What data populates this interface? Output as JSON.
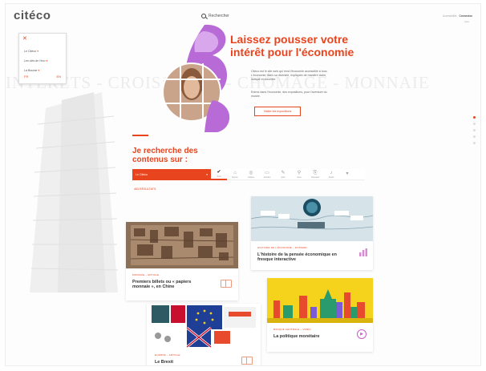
{
  "header": {
    "logo_text": "citéco",
    "logo_accent_letter": "é",
    "search_label": "Rechercher",
    "top_links": [
      "Accessibilité",
      "Connexion"
    ],
    "top_link_sub": "Aide"
  },
  "popup": {
    "close_symbol": "✕",
    "items": [
      {
        "label": "Le Citéco",
        "caret": "▾"
      },
      {
        "label": "Les clés de l'éco",
        "caret": "▾"
      },
      {
        "label": "La Bourse",
        "caret": "▾"
      }
    ],
    "footer_left": "FR",
    "footer_right": "EN"
  },
  "background": {
    "watermark": "INTÉRÊTS - CROISSANCE - CHÔMAGE - MONNAIE"
  },
  "hero": {
    "title": "Laissez pousser votre intérêt pour l'économie",
    "paragraph1": "Citéco est le site web qui rend l'économie accessible à tous. L'économie, dans sa diversité, expliquée de manière claire, ludique et concrète.",
    "paragraph2": "Entrez dans l'économie, des expositions, pour l'aventure du musée.",
    "button": "Visiter les expositions"
  },
  "side_nav": {
    "count": 5,
    "active_index": 0
  },
  "search_section": {
    "title": "Je recherche des contenus sur :",
    "select_value": "Le Citéco",
    "select_caret": "▾",
    "types": [
      {
        "symbol": "✔",
        "label": "Tous",
        "active": true
      },
      {
        "symbol": "⌂",
        "label": "Expos",
        "active": false
      },
      {
        "symbol": "◎",
        "label": "Vidéos",
        "active": false
      },
      {
        "symbol": "▭",
        "label": "Articles",
        "active": false
      },
      {
        "symbol": "✎",
        "label": "Quiz",
        "active": false
      },
      {
        "symbol": "⚲",
        "label": "Jeux",
        "active": false
      },
      {
        "symbol": "⎘",
        "label": "Dossiers",
        "active": false
      },
      {
        "symbol": "♪",
        "label": "Audio",
        "active": false
      }
    ],
    "more_caret": "▾",
    "results_label": "463 RÉSULTATS"
  },
  "cards": [
    {
      "category": "MONNAIE – ARTICLE",
      "title": "Premiers billets ou « papiers monnaie », en Chine",
      "icon": "book-icon"
    },
    {
      "category": "HISTOIRE DE L'ÉCONOMIE – DOSSIER",
      "title": "L'histoire de la pensée économique en fresque interactive",
      "icon": "chart-icon"
    },
    {
      "category": "BANQUE CENTRALE – VIDÉO",
      "title": "La politique monétaire",
      "icon": "play-icon",
      "play_symbol": "▶"
    },
    {
      "category": "EUROPE – ARTICLE",
      "title": "Le Brexit",
      "icon": "book-icon"
    }
  ],
  "colors": {
    "accent": "#e8441e",
    "purple": "#a854c9",
    "video_bg": "#f5d21c"
  }
}
